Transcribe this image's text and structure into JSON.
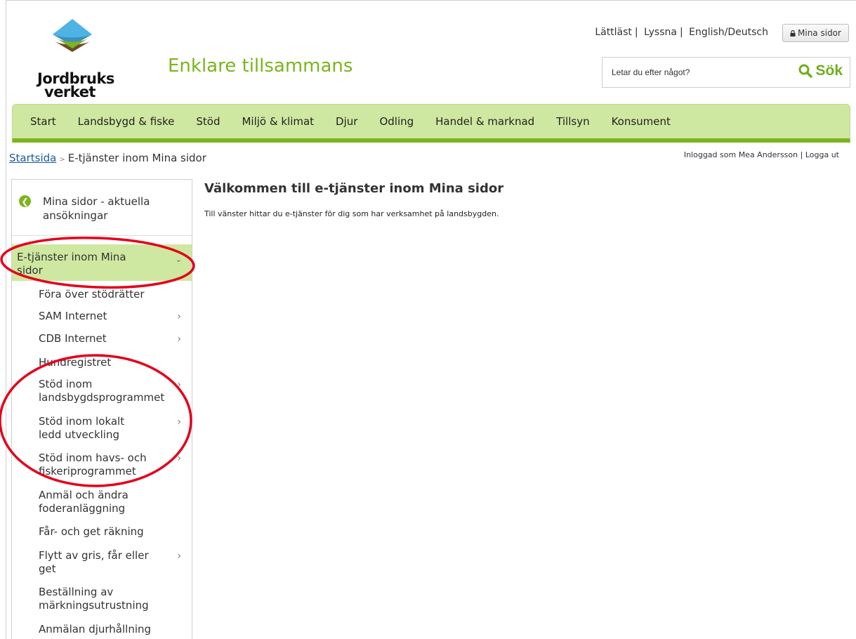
{
  "header": {
    "logo_line1": "Jordbruks",
    "logo_line2": "verket",
    "tagline": "Enklare tillsammans",
    "toplinks": [
      "Lättläst",
      "Lyssna",
      "English/Deutsch"
    ],
    "toplink_separator": "|",
    "mina_sidor_button": "Mina sidor",
    "search_placeholder": "Letar du efter något?",
    "search_button": "Sök"
  },
  "nav": {
    "items": [
      "Start",
      "Landsbygd & fiske",
      "Stöd",
      "Miljö & klimat",
      "Djur",
      "Odling",
      "Handel & marknad",
      "Tillsyn",
      "Konsument"
    ]
  },
  "breadcrumb": {
    "home": "Startsida",
    "separator": ">",
    "current": "E-tjänster inom Mina sidor"
  },
  "login": {
    "text": "Inloggad som Mea Andersson",
    "separator": "|",
    "logout": "Logga ut"
  },
  "sidebar": {
    "back_line1": "Mina sidor - aktuella",
    "back_line2": "ansökningar",
    "active_line1": "E-tjänster inom Mina",
    "active_line2": "sidor",
    "items": [
      {
        "line1": "Föra över stödrätter",
        "line2": ""
      },
      {
        "line1": "SAM Internet",
        "line2": ""
      },
      {
        "line1": "CDB Internet",
        "line2": ""
      },
      {
        "line1": "Hundregistret",
        "line2": ""
      },
      {
        "line1": "Stöd inom",
        "line2": "landsbygdsprogrammet"
      },
      {
        "line1": "Stöd inom lokalt",
        "line2": "ledd utveckling"
      },
      {
        "line1": "Stöd inom havs- och",
        "line2": "fiskeriprogrammet"
      },
      {
        "line1": "Anmäl och ändra",
        "line2": "foderanläggning"
      },
      {
        "line1": "Får- och get räkning",
        "line2": ""
      },
      {
        "line1": "Flytt av gris, får eller",
        "line2": "get"
      },
      {
        "line1": "Beställning av",
        "line2": "märkningsutrustning"
      },
      {
        "line1": "Anmälan djurhållning",
        "line2": ""
      }
    ]
  },
  "main": {
    "title": "Välkommen till e-tjänster inom Mina sidor",
    "text": "Till vänster hittar du e-tjänster för dig som har verksamhet på landsbygden."
  },
  "colors": {
    "brand_green": "#7ab51d",
    "nav_bg": "#cfe8a1",
    "annotation_red": "#e3001b"
  }
}
